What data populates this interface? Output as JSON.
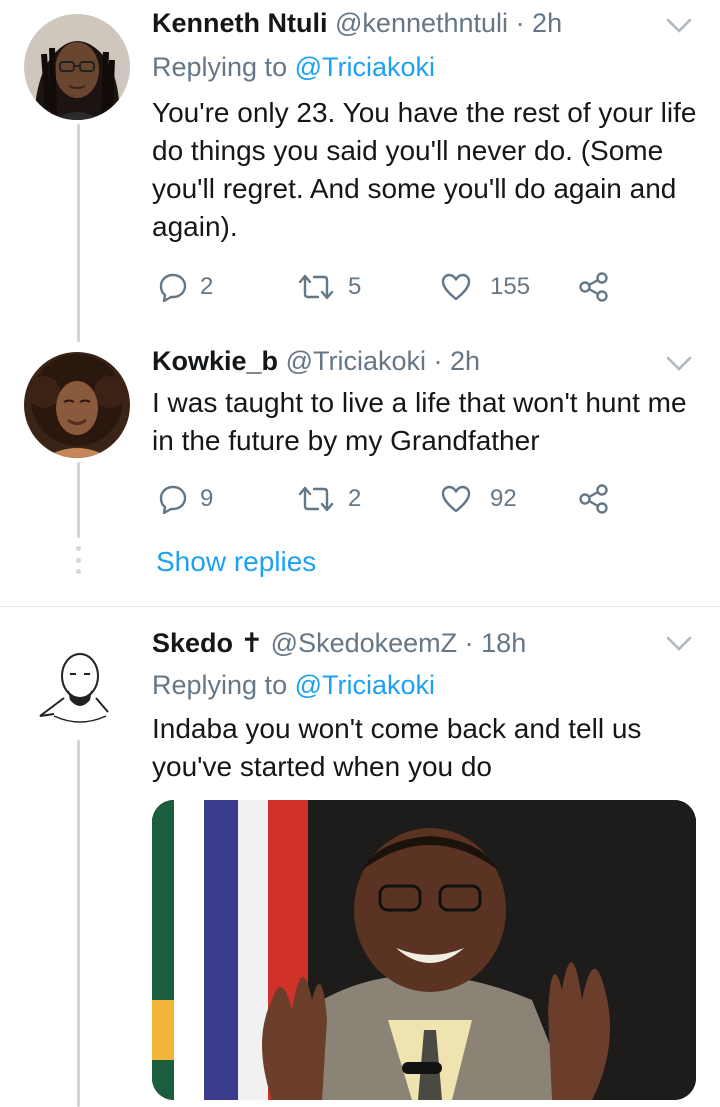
{
  "tweets": [
    {
      "name": "Kenneth Ntuli",
      "handle": "@kennethntuli",
      "time": "· 2h",
      "replying_prefix": "Replying to",
      "replying_to": "@Triciakoki",
      "text": "You're only 23. You have the rest of your life do things you said you'll never do. (Some you'll regret. And some you'll do again and again).",
      "replies": "2",
      "retweets": "5",
      "likes": "155",
      "avatar": "man-with-dreadlocks-and-glasses-avatar"
    },
    {
      "name": "Kowkie_b",
      "handle": "@Triciakoki",
      "time": "· 2h",
      "text": "I was taught to live a life that  won't hunt me in the future by my Grandfather",
      "replies": "9",
      "retweets": "2",
      "likes": "92",
      "avatar": "smiling-woman-with-curly-hair-avatar"
    },
    {
      "name": "Skedo ✝",
      "handle": "@SkedokeemZ",
      "time": "· 18h",
      "replying_prefix": "Replying to",
      "replying_to": "@Triciakoki",
      "text": "Indaba you won't come back and tell us you've started when you do",
      "avatar": "sketched-bald-man-avatar",
      "media": "photo-of-laughing-man-in-suit-beside-flag"
    }
  ],
  "thread": {
    "show_replies": "Show replies"
  },
  "icons": {
    "reply": "reply-icon",
    "retweet": "retweet-icon",
    "like": "heart-icon",
    "share": "share-icon",
    "menu": "chevron-down-icon"
  },
  "colors": {
    "link": "#1da1f2",
    "muted": "#657786",
    "text": "#14171a",
    "thread_line": "#ccd6dd"
  }
}
